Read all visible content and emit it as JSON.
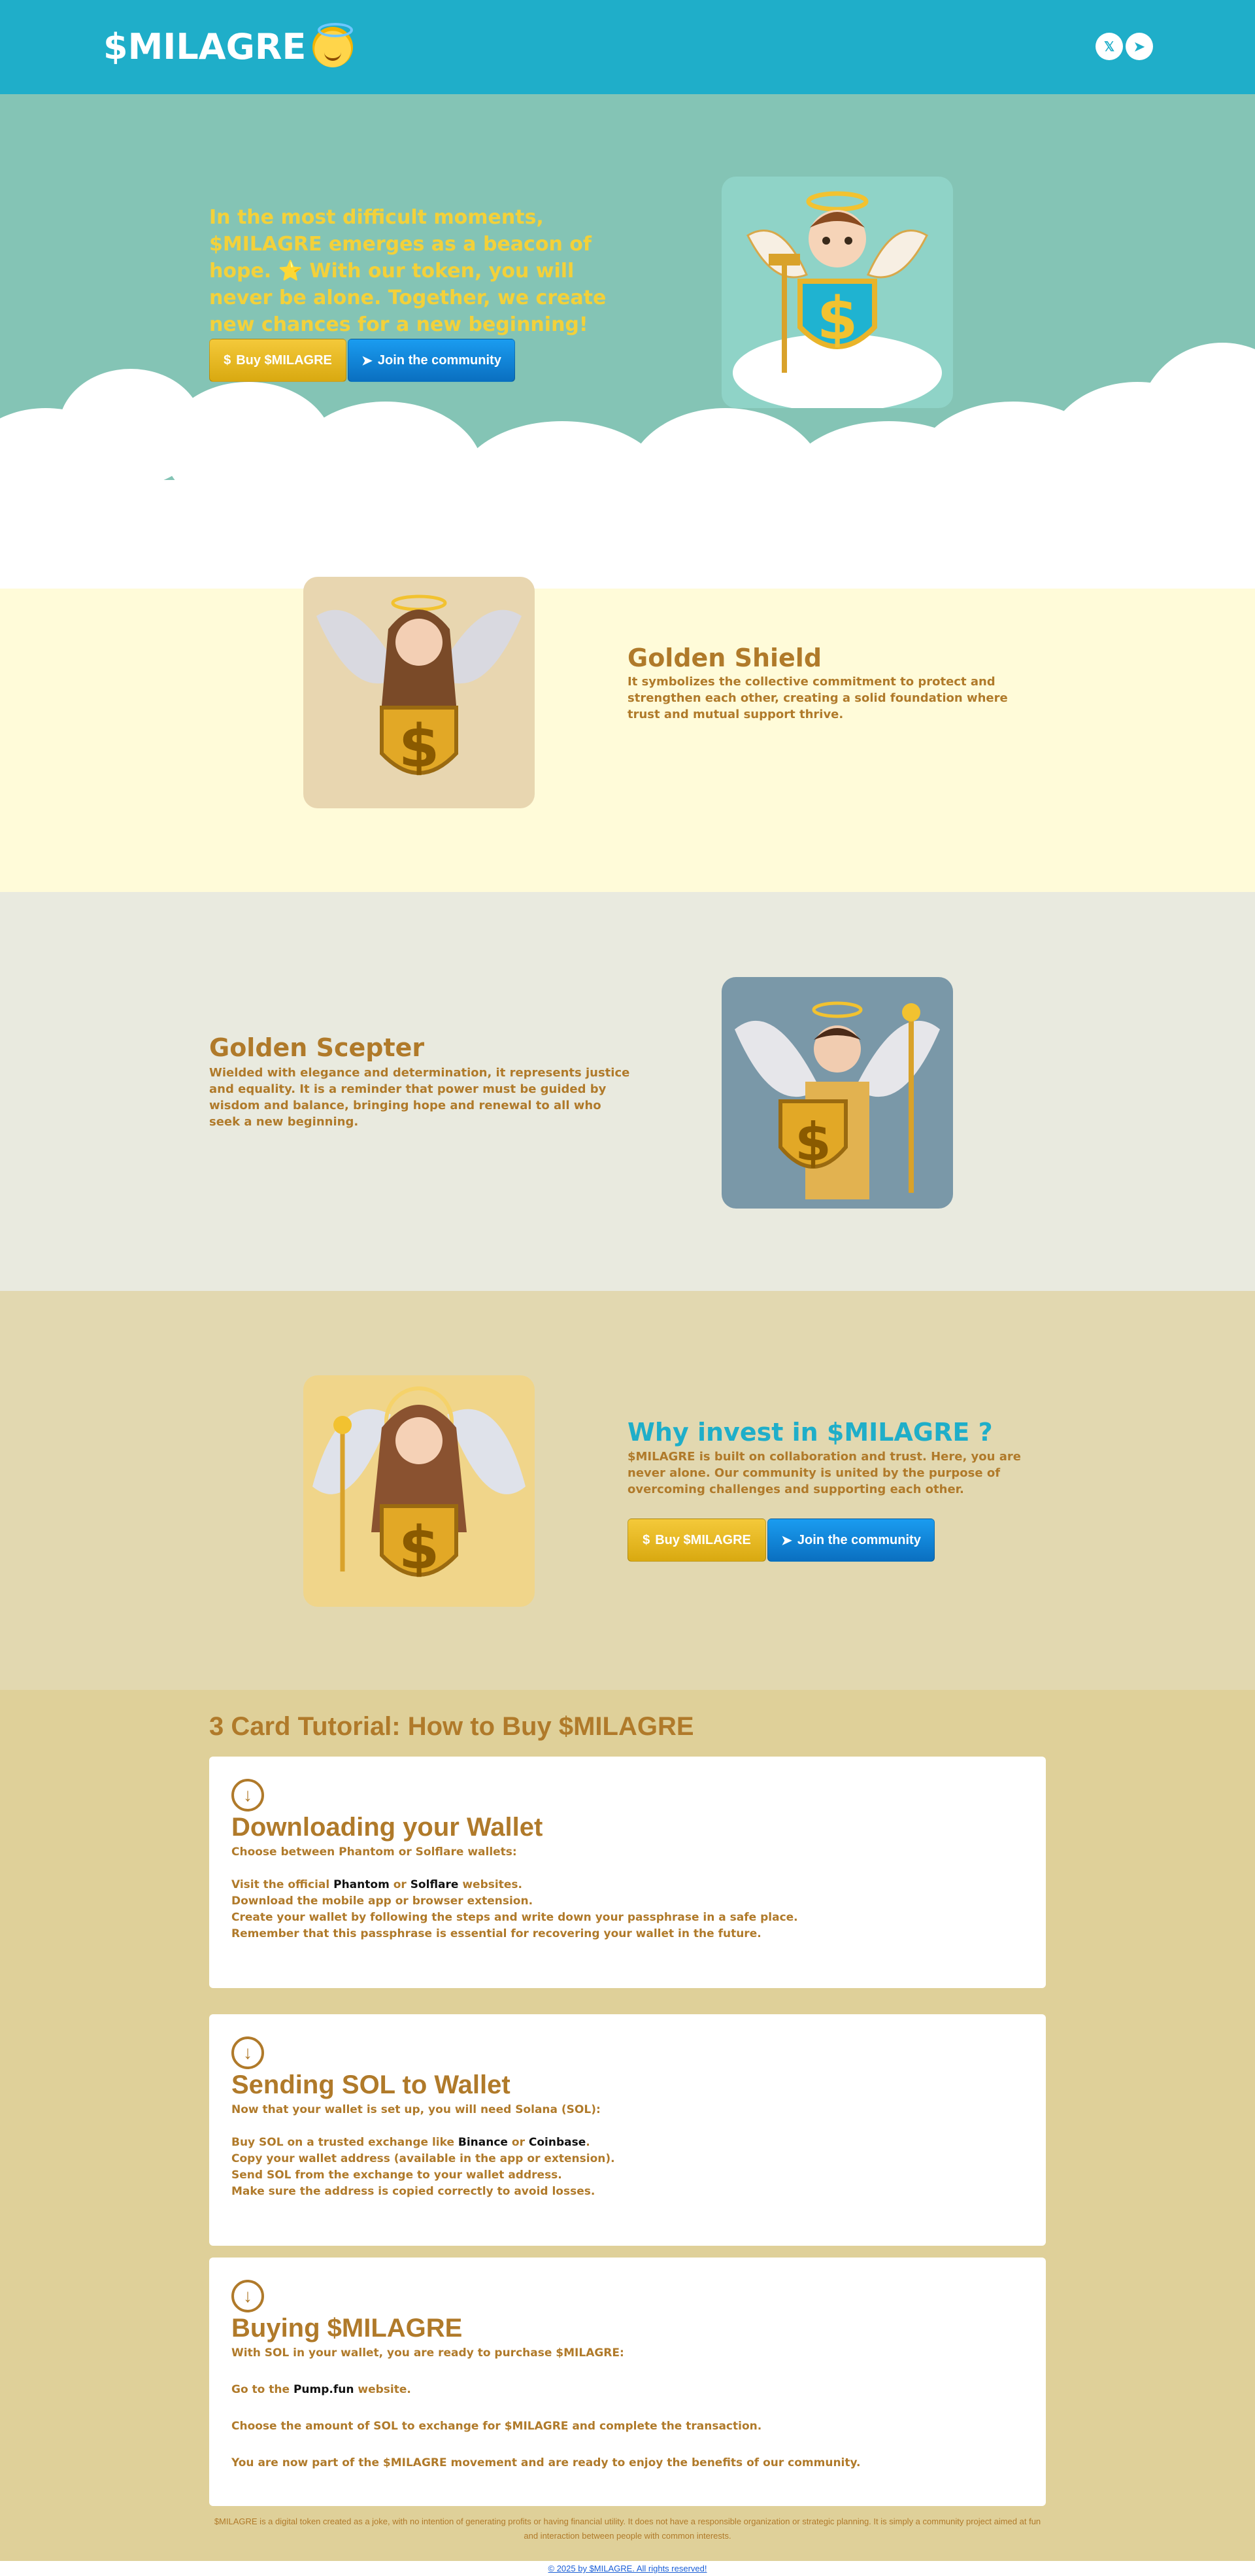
{
  "header": {
    "brand": "$MILAGRE",
    "brand_emoji_icon": "smiling-face-with-halo-icon",
    "social": [
      {
        "name": "x-twitter-icon",
        "glyph": "𝕏"
      },
      {
        "name": "telegram-icon",
        "glyph": "➤"
      }
    ]
  },
  "hero": {
    "text": "In the most difficult moments, $MILAGRE emerges as a beacon of hope. ⭐ With our token, you will never be alone. Together, we create new chances for a new beginning!",
    "buy_label": "Buy $MILAGRE",
    "join_label": "Join the community",
    "image_icon": "cherub-angel-with-dollar-shield-image"
  },
  "shield": {
    "title": "Golden Shield",
    "desc": "It symbolizes the collective commitment to protect and strengthen each other, creating a solid foundation where trust and mutual support thrive.",
    "image_icon": "female-angel-with-dollar-shield-image"
  },
  "scepter": {
    "title": "Golden Scepter",
    "desc": "Wielded with elegance and determination, it represents justice and equality. It is a reminder that power must be guided by wisdom and balance, bringing hope and renewal to all who seek a new beginning.",
    "image_icon": "male-angel-with-scepter-image"
  },
  "invest": {
    "title": "Why invest in $MILAGRE ?",
    "desc": "$MILAGRE is built on collaboration and trust. Here, you are never alone. Our community is united by the purpose of overcoming challenges and supporting each other.",
    "buy_label": "Buy $MILAGRE",
    "join_label": "Join the community",
    "image_icon": "female-angel-with-scepter-image"
  },
  "tutorial": {
    "title": "3 Card Tutorial: How to Buy $MILAGRE",
    "cards": [
      {
        "title": "Downloading your Wallet",
        "intro": "Choose between Phantom or Solflare wallets:",
        "line1_pre": "Visit the official ",
        "link_a": "Phantom",
        "line1_mid": " or ",
        "link_b": "Solflare",
        "line1_post": " websites.",
        "line2": "Download the mobile app or browser extension.",
        "line3": "Create your wallet by following the steps and write down your passphrase in a safe place.",
        "line4": "Remember that this passphrase is essential for recovering your wallet in the future."
      },
      {
        "title": "Sending SOL to Wallet",
        "intro": "Now that your wallet is set up, you will need Solana (SOL):",
        "line1_pre": "Buy SOL on a trusted exchange like ",
        "link_a": "Binance",
        "line1_mid": " or ",
        "link_b": "Coinbase",
        "line1_post": ".",
        "line2": "Copy your wallet address (available in the app or extension).",
        "line3": "Send SOL from the exchange to your wallet address.",
        "line4": "Make sure the address is copied correctly to avoid losses."
      },
      {
        "title": "Buying $MILAGRE",
        "intro": "With SOL in your wallet, you are ready to purchase $MILAGRE:",
        "line1_pre": "Go to the ",
        "link_a": "Pump.fun",
        "line1_post": " website.",
        "line2": "Choose the amount of SOL to exchange for $MILAGRE and complete the transaction.",
        "line3": "You are now part of the $MILAGRE movement and are ready to enjoy the benefits of our community."
      }
    ]
  },
  "footer": {
    "disclaimer": "$MILAGRE is a digital token created as a joke, with no intention of generating profits or having financial utility. It does not have a responsible organization or strategic planning. It is simply a community project aimed at fun and interaction between people with common interests.",
    "copyright": "© 2025 by $MILAGRE. All rights reserved!"
  },
  "colors": {
    "header_bg": "#1faec9",
    "hero_bg": "#84c4b5",
    "shield_bg": "#fffbd9",
    "scepter_bg": "#e9eadf",
    "invest_bg": "#e2d8b0",
    "tutorial_bg": "#dfd099",
    "brown_text": "#b07a2a",
    "yellow_text": "#f3d13a",
    "teal_title": "#1faec9"
  }
}
